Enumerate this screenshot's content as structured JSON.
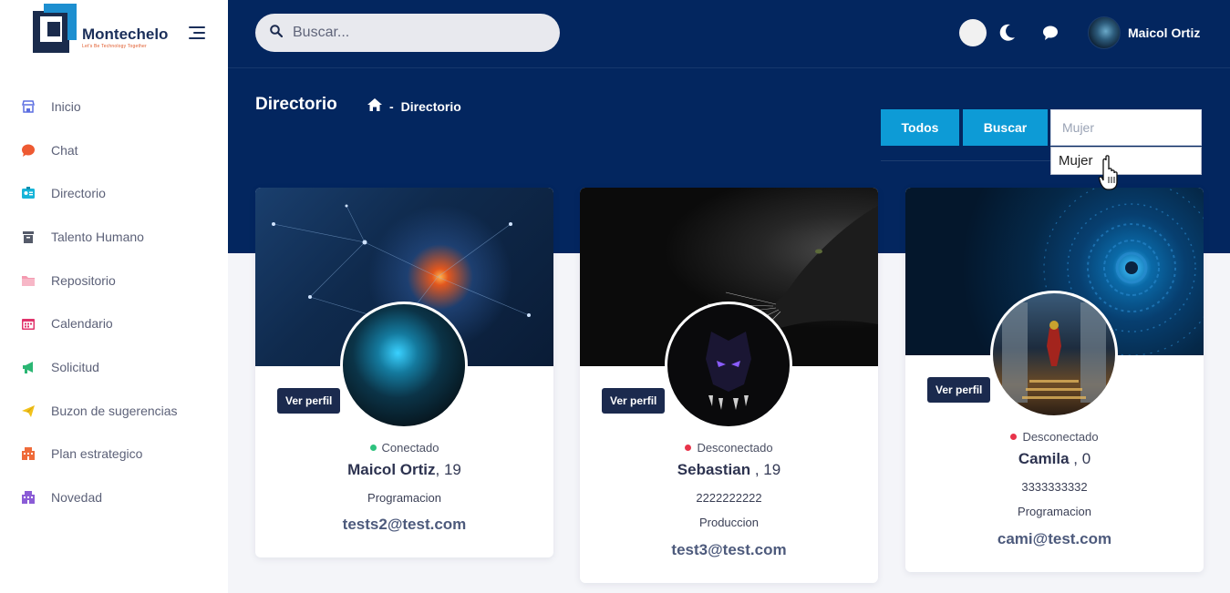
{
  "brand": {
    "name": "Montechelo",
    "tagline": "Let's Be Technology Together"
  },
  "search": {
    "placeholder": "Buscar..."
  },
  "user": {
    "name": "Maicol Ortiz"
  },
  "sidebar": {
    "items": [
      {
        "label": "Inicio",
        "icon": "store-icon",
        "color": "#5b6ee1"
      },
      {
        "label": "Chat",
        "icon": "chat-bubble-icon",
        "color": "#ee5a32"
      },
      {
        "label": "Directorio",
        "icon": "id-card-icon",
        "color": "#16b4d8"
      },
      {
        "label": "Talento Humano",
        "icon": "archive-icon",
        "color": "#555b6a"
      },
      {
        "label": "Repositorio",
        "icon": "folder-icon",
        "color": "#f49ab0"
      },
      {
        "label": "Calendario",
        "icon": "calendar-icon",
        "color": "#e0336b"
      },
      {
        "label": "Solicitud",
        "icon": "megaphone-icon",
        "color": "#2bb673"
      },
      {
        "label": "Buzon de sugerencias",
        "icon": "paper-plane-icon",
        "color": "#f2c21b"
      },
      {
        "label": "Plan estrategico",
        "icon": "building-icon",
        "color": "#ef6b3a"
      },
      {
        "label": "Novedad",
        "icon": "building-icon",
        "color": "#8b5cd6"
      }
    ]
  },
  "page": {
    "title": "Directorio",
    "breadcrumb": "Directorio",
    "breadcrumb_sep": "-"
  },
  "filters": {
    "todos_label": "Todos",
    "buscar_label": "Buscar",
    "input_value": "",
    "input_placeholder": "Mujer",
    "suggestion": "Mujer"
  },
  "cards": [
    {
      "status": "Conectado",
      "status_color": "#2ec27e",
      "name": "Maicol Ortiz",
      "age": ", 19",
      "phone": "",
      "area": "Programacion",
      "email": "tests2@test.com",
      "button": "Ver perfil"
    },
    {
      "status": "Desconectado",
      "status_color": "#e8334a",
      "name": "Sebastian",
      "age": " , 19",
      "phone": "2222222222",
      "area": "Produccion",
      "email": "test3@test.com",
      "button": "Ver perfil"
    },
    {
      "status": "Desconectado",
      "status_color": "#e8334a",
      "name": "Camila",
      "age": " , 0",
      "phone": "3333333332",
      "area": "Programacion",
      "email": "cami@test.com",
      "button": "Ver perfil"
    }
  ],
  "colors": {
    "hero": "#03265f",
    "accent_button": "#0d9bd6",
    "dark_button": "#1b2a4e"
  }
}
